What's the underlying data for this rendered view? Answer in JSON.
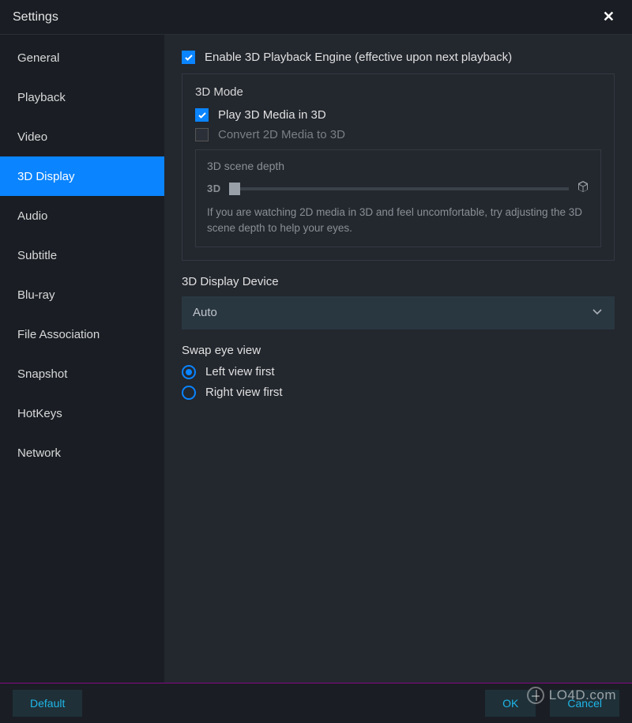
{
  "window": {
    "title": "Settings"
  },
  "sidebar": {
    "items": [
      {
        "label": "General"
      },
      {
        "label": "Playback"
      },
      {
        "label": "Video"
      },
      {
        "label": "3D Display"
      },
      {
        "label": "Audio"
      },
      {
        "label": "Subtitle"
      },
      {
        "label": "Blu-ray"
      },
      {
        "label": "File Association"
      },
      {
        "label": "Snapshot"
      },
      {
        "label": "HotKeys"
      },
      {
        "label": "Network"
      }
    ],
    "active_index": 3
  },
  "main": {
    "enable_3d_label": "Enable 3D Playback Engine (effective upon next playback)",
    "mode_panel_title": "3D Mode",
    "play_3d_label": "Play 3D Media in 3D",
    "convert_2d_label": "Convert 2D Media to 3D",
    "depth_panel_title": "3D scene depth",
    "depth_slider_label": "3D",
    "depth_hint": "If you are watching 2D media in 3D and feel uncomfortable, try adjusting the 3D scene depth to help your eyes.",
    "device_label": "3D Display Device",
    "device_value": "Auto",
    "swap_label": "Swap eye view",
    "radio_left": "Left view first",
    "radio_right": "Right view first"
  },
  "footer": {
    "default": "Default",
    "ok": "OK",
    "cancel": "Cancel"
  },
  "watermark": "LO4D.com"
}
